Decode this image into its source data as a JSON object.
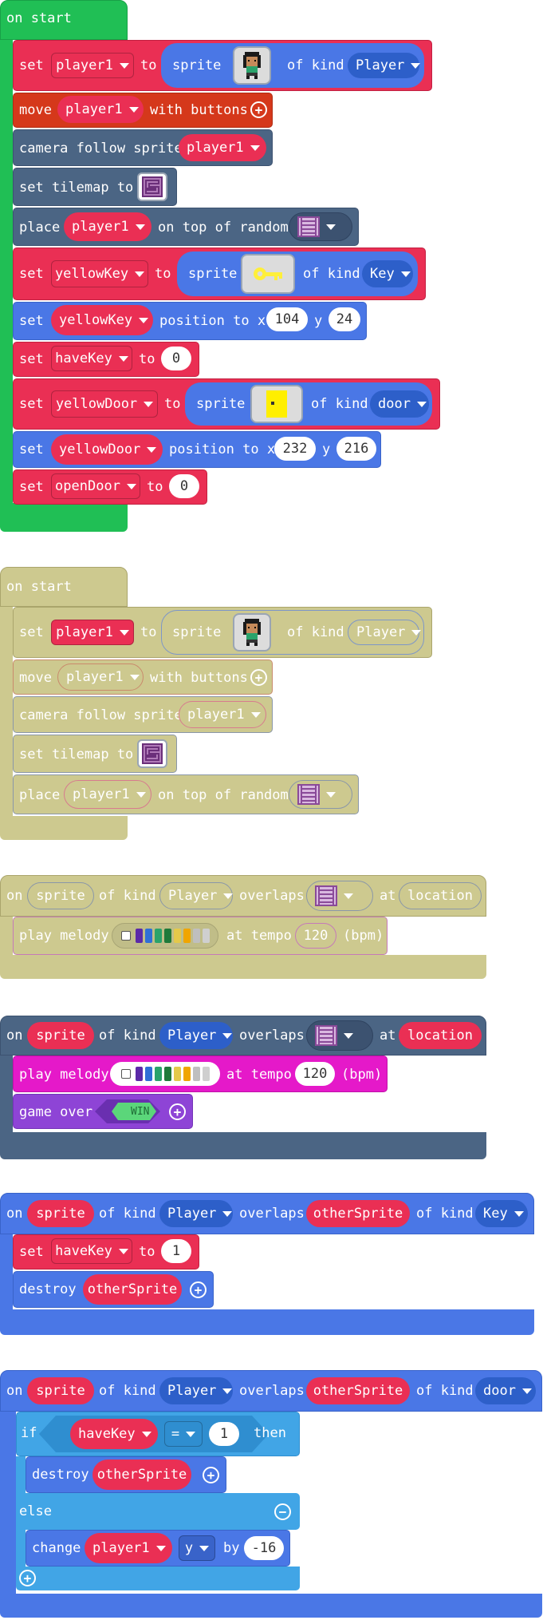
{
  "colors": {
    "loops_green": "#20bf55",
    "variables_red": "#ea2f54",
    "controller_orange": "#d5381b",
    "scene_slate": "#4b6584",
    "sprites_blue": "#4a77e6",
    "music_pink": "#e519c9",
    "game_purple": "#8e44d6",
    "logic_lightblue": "#41a5e6",
    "disabled_khaki": "#cdc98f"
  },
  "b1": {
    "hat": "on start",
    "set": "set",
    "to": "to",
    "sprite": "sprite",
    "of_kind": "of kind",
    "player1": "player1",
    "player": "Player",
    "move": "move",
    "with_buttons": "with buttons",
    "camera_follow": "camera follow sprite",
    "set_tilemap": "set tilemap to",
    "place": "place",
    "on_top_of_random": "on top of random",
    "yellowKey": "yellowKey",
    "key": "Key",
    "position_to_x": "position to x",
    "y": "y",
    "yk_x": "104",
    "yk_y": "24",
    "haveKey": "haveKey",
    "zero": "0",
    "yellowDoor": "yellowDoor",
    "door": "door",
    "yd_x": "232",
    "yd_y": "216",
    "openDoor": "openDoor"
  },
  "b3": {
    "on": "on",
    "sprite": "sprite",
    "of_kind": "of kind",
    "player": "Player",
    "overlaps": "overlaps",
    "at": "at",
    "location": "location",
    "play_melody": "play melody",
    "at_tempo": "at tempo",
    "tempo": "120",
    "bpm": "(bpm)",
    "game_over": "game over",
    "win": "WIN"
  },
  "b5": {
    "on": "on",
    "sprite": "sprite",
    "of_kind": "of kind",
    "player": "Player",
    "overlaps": "overlaps",
    "otherSprite": "otherSprite",
    "key": "Key",
    "door": "door",
    "set": "set",
    "haveKey": "haveKey",
    "to": "to",
    "one": "1",
    "destroy": "destroy",
    "if": "if",
    "then": "then",
    "eq": "=",
    "else": "else",
    "change": "change",
    "player1": "player1",
    "y": "y",
    "by": "by",
    "delta": "-16"
  },
  "melody_colors": [
    "#ffffff",
    "#5b2aa8",
    "#2f6fd6",
    "#2aa36b",
    "#1f7a3a",
    "#e4c94a",
    "#f0a500",
    "#bfbfbf",
    "#cfcfcf"
  ]
}
